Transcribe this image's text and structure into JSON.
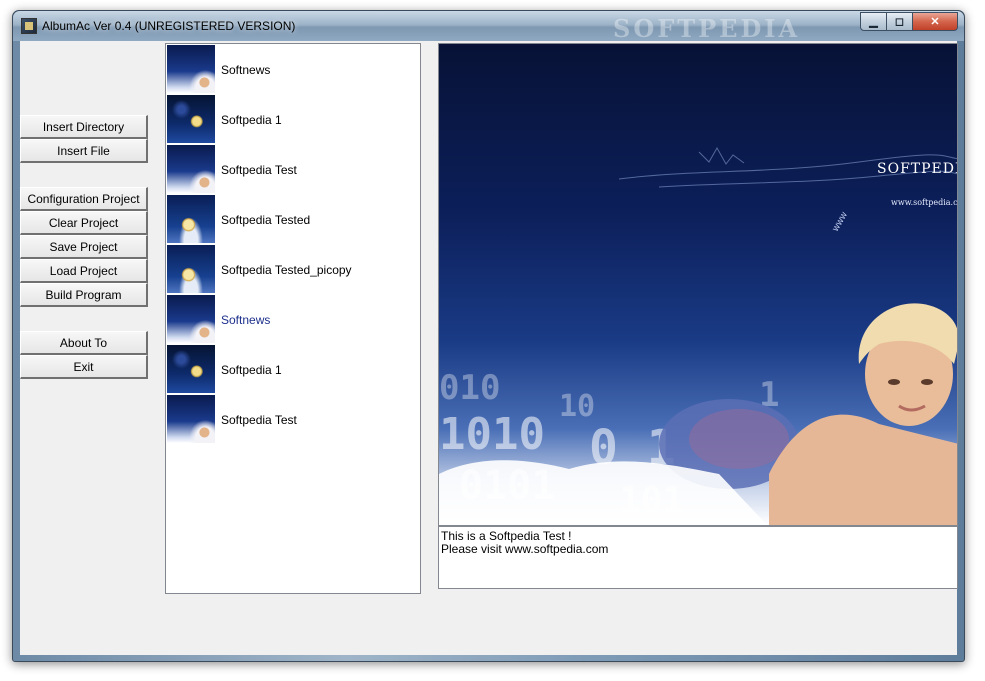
{
  "window": {
    "title": "AlbumAc Ver 0.4 (UNREGISTERED VERSION)",
    "watermark": "SOFTPEDIA"
  },
  "caption_buttons": {
    "minimize": "▁",
    "maximize": "◻",
    "close": "✕"
  },
  "buttons": {
    "insert_directory": "Insert Directory",
    "insert_file": "Insert File",
    "configuration_project": "Configuration Project",
    "clear_project": "Clear Project",
    "save_project": "Save Project",
    "load_project": "Load Project",
    "build_program": "Build Program",
    "about_to": "About To",
    "exit": "Exit"
  },
  "album_list": {
    "items": [
      {
        "label": "Softnews",
        "thumbnail": "blonde-woman-thumbnail"
      },
      {
        "label": "Softpedia 1",
        "thumbnail": "moon-thumbnail"
      },
      {
        "label": "Softpedia Test",
        "thumbnail": "blonde-woman-thumbnail"
      },
      {
        "label": "Softpedia Tested",
        "thumbnail": "moon-fish-thumbnail"
      },
      {
        "label": "Softpedia Tested_picopy",
        "thumbnail": "moon-fish-thumbnail"
      },
      {
        "label": "Softnews",
        "thumbnail": "blonde-woman-thumbnail",
        "selected": true
      },
      {
        "label": "Softpedia 1",
        "thumbnail": "moon-thumbnail"
      },
      {
        "label": "Softpedia Test",
        "thumbnail": "blonde-woman-thumbnail"
      }
    ]
  },
  "preview": {
    "brand": "SOFTPEDIA",
    "brand_url": "www.softpedia.com"
  },
  "description": {
    "line1": "This is a Softpedia Test !",
    "line2": "Please visit www.softpedia.com"
  },
  "colors": {
    "selected_text": "#1c2f8c",
    "client_background": "#f0f0f0",
    "preview_background": "#0c1f5a"
  }
}
